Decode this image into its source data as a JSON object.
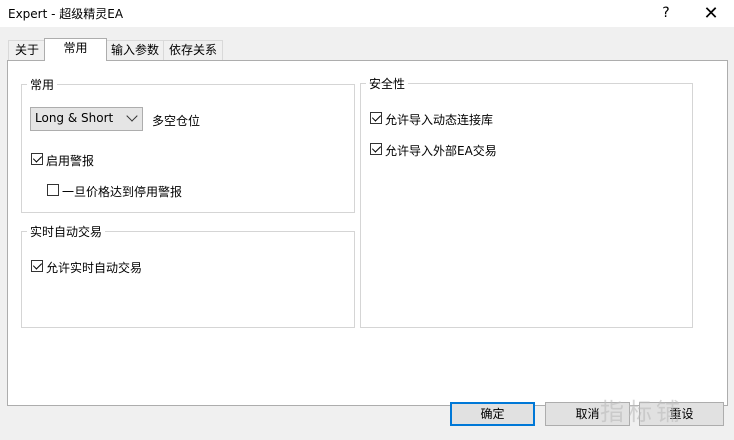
{
  "window": {
    "title": "Expert - 超级精灵EA",
    "help": "?",
    "close": "✕"
  },
  "tabs": [
    "关于",
    "常用",
    "输入参数",
    "依存关系"
  ],
  "general": {
    "legend": "常用",
    "position_select": {
      "value": "Long & Short"
    },
    "position_label": "多空仓位",
    "enable_alerts": {
      "label": "启用警报",
      "checked": true
    },
    "disable_on_stop": {
      "label": "一旦价格达到停用警报",
      "checked": false
    }
  },
  "live": {
    "legend": "实时自动交易",
    "allow_live": {
      "label": "允许实时自动交易",
      "checked": true
    }
  },
  "security": {
    "legend": "安全性",
    "allow_dll": {
      "label": "允许导入动态连接库",
      "checked": true
    },
    "allow_ext": {
      "label": "允许导入外部EA交易",
      "checked": true
    }
  },
  "buttons": {
    "ok": "确定",
    "cancel": "取消",
    "reset": "重设"
  },
  "watermark": "指标铺"
}
